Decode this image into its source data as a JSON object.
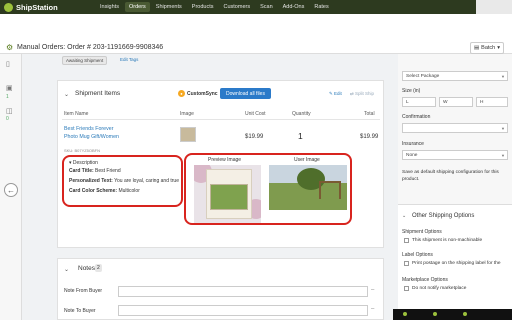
{
  "app": {
    "name": "ShipStation"
  },
  "nav": [
    "Insights",
    "Orders",
    "Shipments",
    "Products",
    "Customers",
    "Scan",
    "Add-Ons",
    "Rates"
  ],
  "header": {
    "title": "Manual Orders:  Order # 203-1191669-9908346",
    "batch_label": "Batch"
  },
  "rail": {
    "count_1": "1",
    "count_2": "0"
  },
  "order": {
    "status": "Awaiting Shipment",
    "edit_tags": "Edit Tags"
  },
  "shipment": {
    "title": "Shipment Items",
    "customsync": "CustomSync",
    "download_all": "Download all files",
    "edit": "Edit",
    "split": "Split Ship",
    "columns": [
      "Item Name",
      "Image",
      "Unit Cost",
      "Quantity",
      "Total"
    ],
    "item": {
      "name": "Best Friends Forever Photo Mug Gift/Women",
      "sku": "SKU: B07YZ5OBFN",
      "unit_cost": "$19.99",
      "quantity": "1",
      "total": "$19.99"
    },
    "description": {
      "heading": "Description",
      "card_title_label": "Card Title:",
      "card_title": "Best Friend",
      "personalized_label": "Personalized Text:",
      "personalized": "You are loyal, caring and true",
      "scheme_label": "Card Color Scheme:",
      "scheme": "Multicolor"
    },
    "preview_label": "Preview Image",
    "user_label": "User Image"
  },
  "notes": {
    "title": "Notes",
    "count": "2",
    "from_buyer": "Note From Buyer",
    "to_buyer": "Note To Buyer",
    "dash": "–"
  },
  "right": {
    "package_placeholder": "Select Package",
    "size_label": "Size (in)",
    "l": "L",
    "w": "W",
    "h": "H",
    "confirmation_label": "Confirmation",
    "insurance_label": "Insurance",
    "insurance_value": "None",
    "default_note": "Save as default shipping configuration for this product.",
    "other_title": "Other Shipping Options",
    "shipment_options": "Shipment Options",
    "non_machinable": "This shipment is non-machinable",
    "label_options": "Label Options",
    "print_postage": "Print postage on the shipping label for the",
    "marketplace_options": "Marketplace Options",
    "do_not_notify": "Do not notify marketplace"
  }
}
